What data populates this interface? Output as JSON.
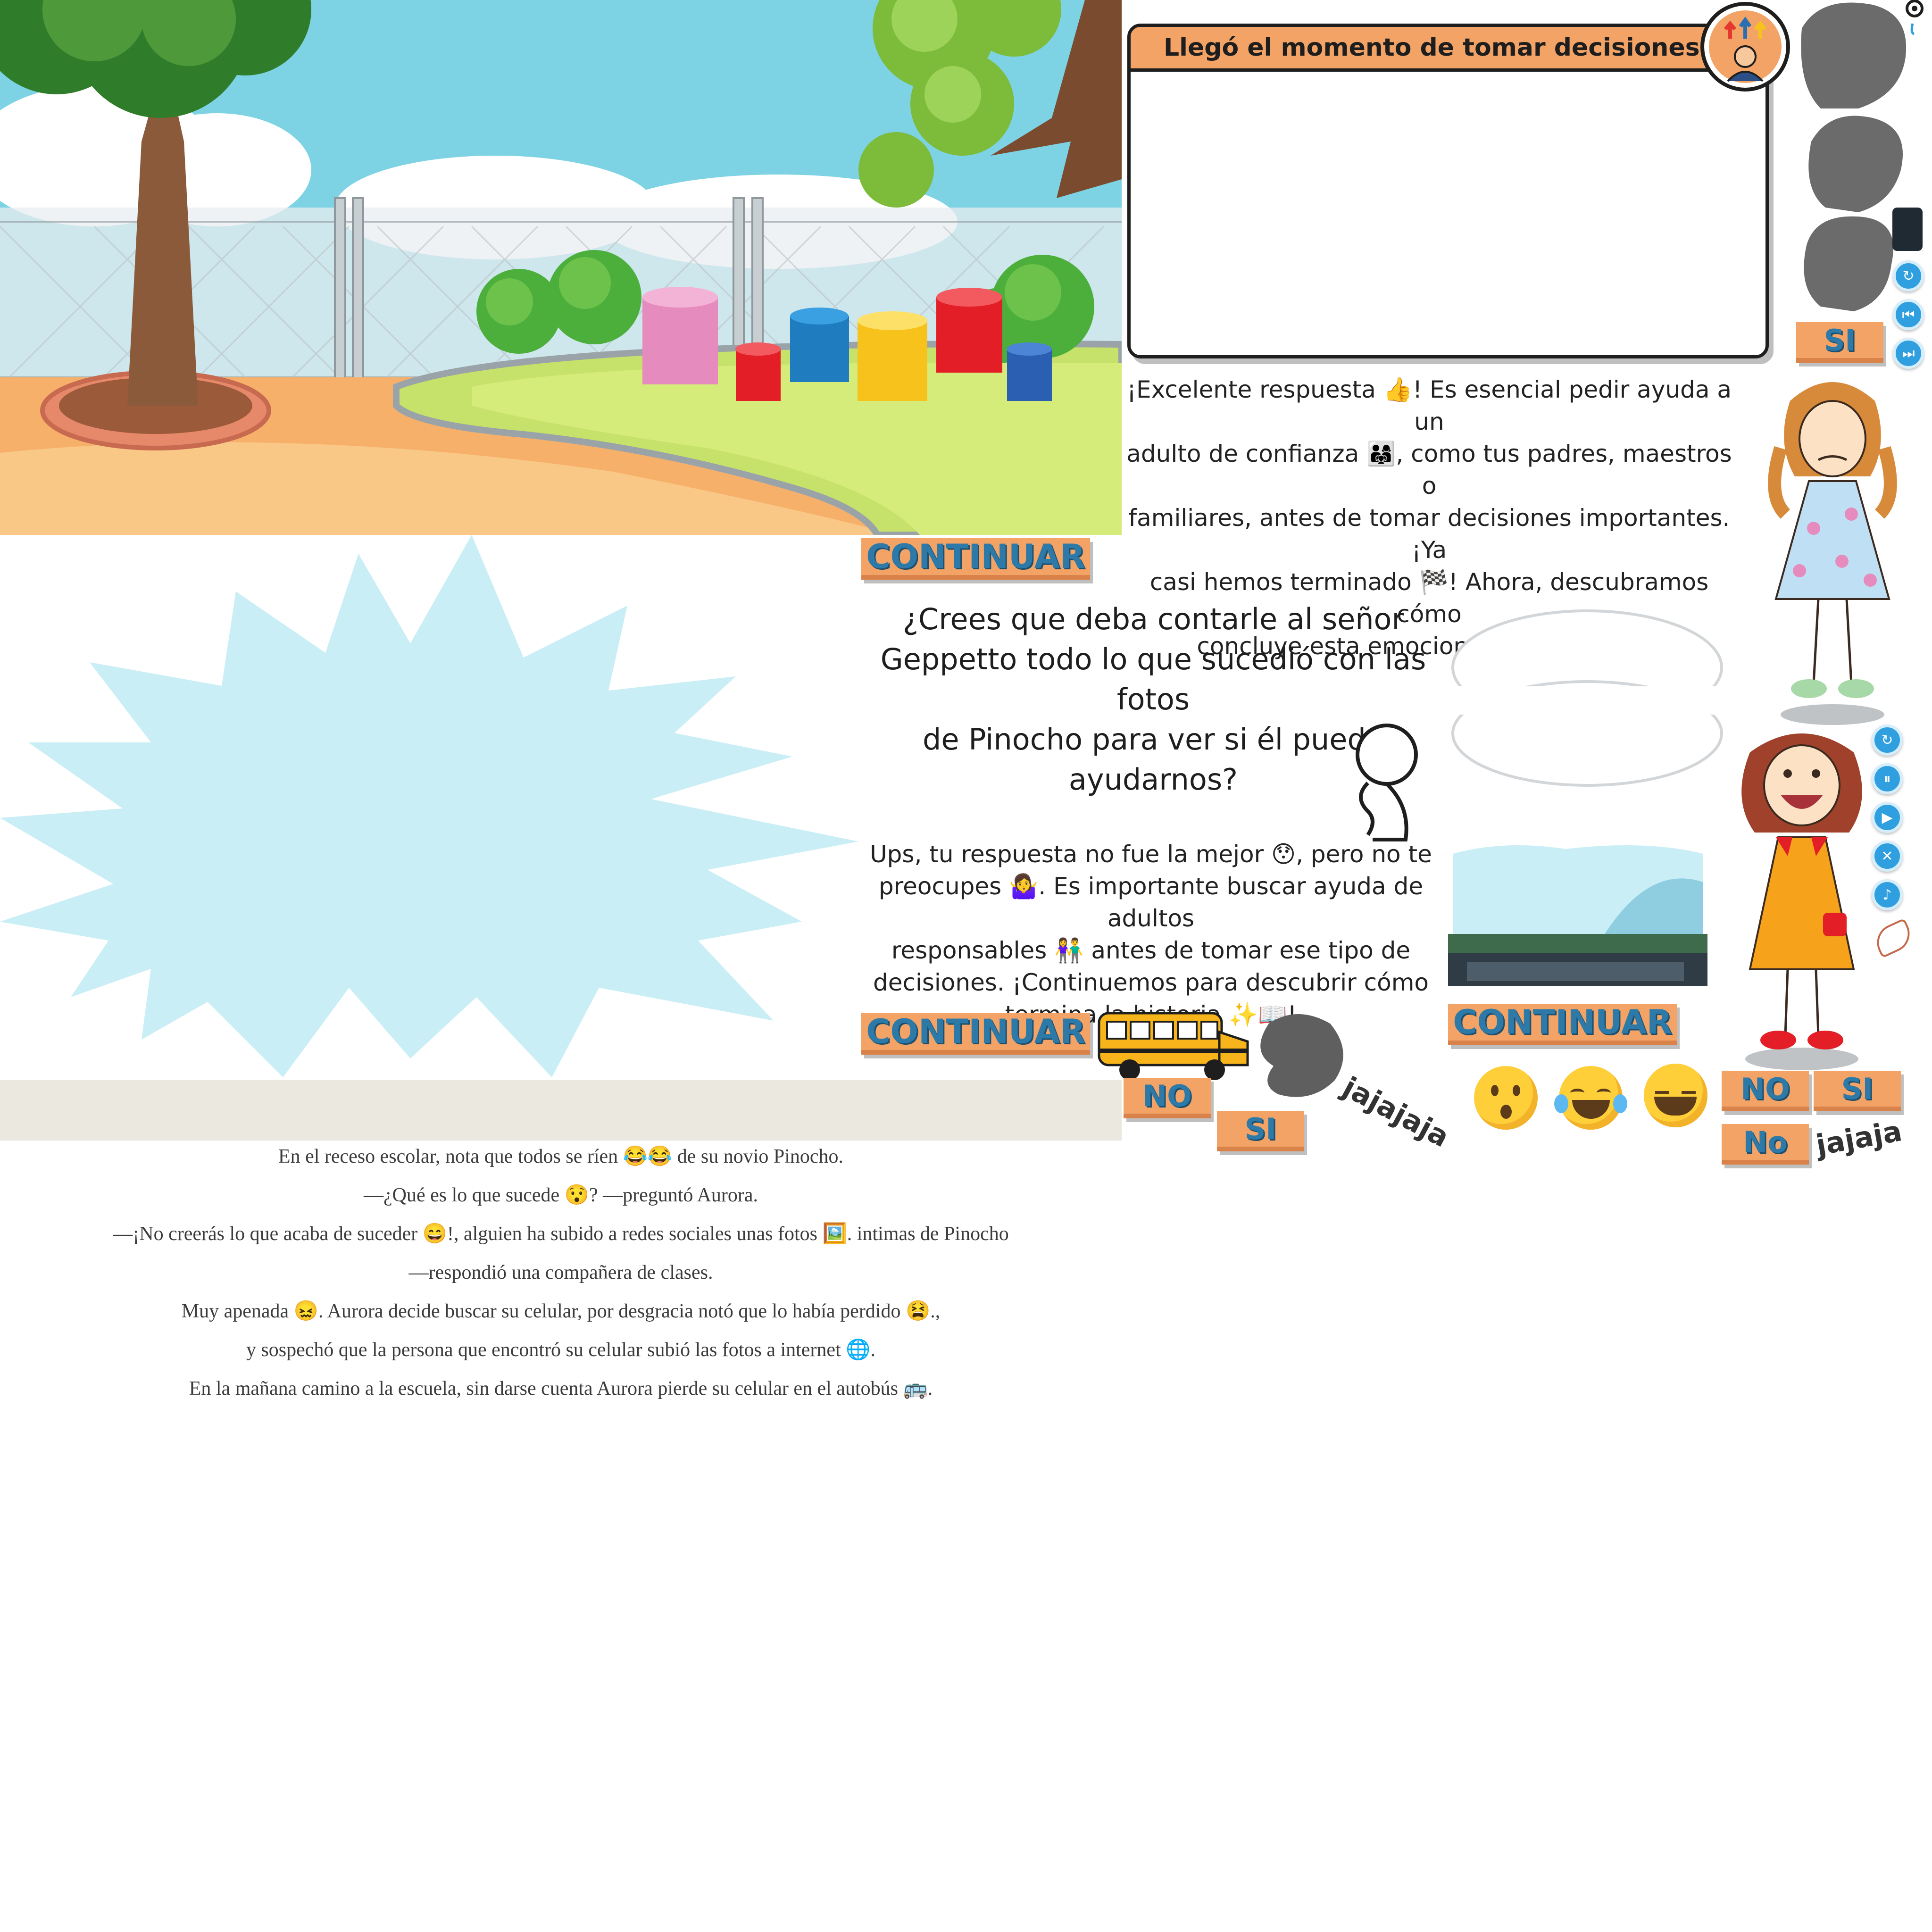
{
  "scene": {
    "colors": {
      "sky": "#7dd3e3",
      "ground": "#f6b06a",
      "grass": "#c6e26a",
      "splash": "#c9eef5"
    }
  },
  "decision_panel": {
    "title": "Llegó el momento de tomar decisiones...",
    "icon": "decision-arrows-person-icon"
  },
  "positive_feedback": {
    "lines": [
      "¡Excelente respuesta 👍! Es esencial pedir ayuda a un",
      "adulto de confianza 👨‍👩‍👧, como tus padres, maestros o",
      "familiares, antes de tomar decisiones importantes. ¡Ya",
      "casi hemos terminado 🏁! Ahora, descubramos cómo",
      "concluye esta emocionante historia 🎉."
    ]
  },
  "question": {
    "lines": [
      "¿Crees que deba contarle al señor",
      "Geppetto todo lo que sucedió con las fotos",
      "de Pinocho  para ver si él puede ayudarnos?"
    ]
  },
  "negative_feedback": {
    "lines": [
      "Ups, tu respuesta no fue la mejor 😯, pero no te",
      "preocupes 🤷‍♀️. Es importante buscar ayuda de adultos",
      "responsables 👫 antes de tomar ese tipo de",
      "decisiones. ¡Continuemos para descubrir cómo",
      "termina la historia ✨📖!"
    ]
  },
  "buttons": {
    "continuar": "CONTINUAR",
    "si": "SI",
    "no": "NO",
    "no_small": "No"
  },
  "labels": {
    "jajajaja": "jajajaja",
    "jajaja": "jajaja"
  },
  "narration": {
    "lines": [
      "En el receso escolar, nota que todos se ríen 😂😂 de su novio Pinocho.",
      "—¿Qué es lo que sucede 😯? —preguntó Aurora.",
      "—¡No creerás lo que acaba de suceder 😄!, alguien ha subido a redes sociales unas fotos 🖼️. intimas de Pinocho",
      "—respondió una compañera de clases.",
      "Muy apenada 😖. Aurora decide buscar su celular, por desgracia notó que lo había perdido 😫.,",
      "y sospechó que la persona que encontró su celular subió las fotos a internet 🌐.",
      "En la mañana camino a la escuela, sin darse cuenta Aurora pierde su celular en el autobús 🚌."
    ]
  },
  "controls": [
    {
      "icon": "replay-icon"
    },
    {
      "icon": "skip-back-icon"
    },
    {
      "icon": "skip-forward-icon"
    },
    {
      "icon": "replay-icon"
    },
    {
      "icon": "pause-icon"
    },
    {
      "icon": "play-icon"
    },
    {
      "icon": "mute-icon"
    },
    {
      "icon": "volume-icon"
    }
  ],
  "emojis": [
    "surprised-emoji",
    "crying-laughing-emoji",
    "grinning-squint-emoji"
  ]
}
